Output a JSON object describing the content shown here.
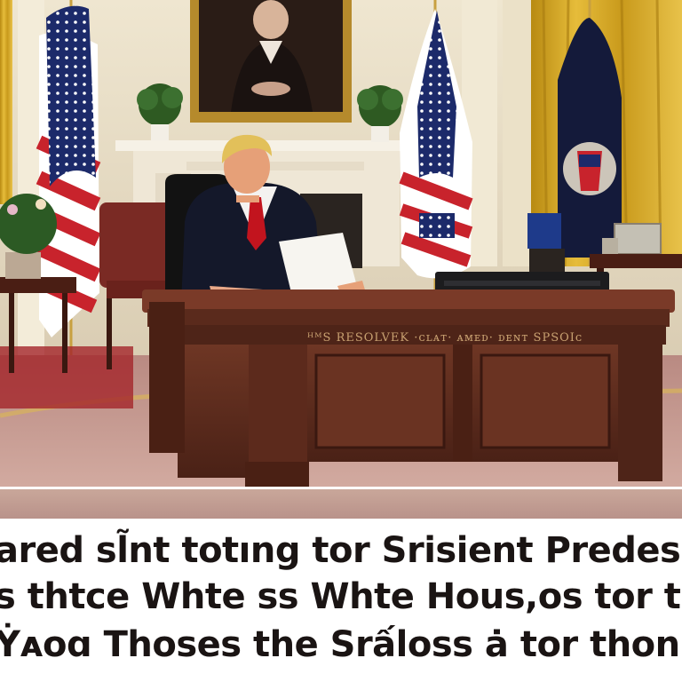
{
  "caption": {
    "line1": "ared sl̃nt totıng tor Srisient Predesin",
    "line2": "s thtce Whte ss Whte Hous,os tor tor",
    "line3": "Ẏᴀᴏɑ Thoses the Srấloss ȧ tor thon th"
  },
  "colors": {
    "wall": "#e6dcc4",
    "curtain": "#d8a820",
    "carpet": "#c99a92",
    "desk": "#5a2a1c",
    "suit": "#14182a",
    "tie": "#c2141e",
    "flag_blue": "#1c2a6a",
    "flag_red": "#c8232c",
    "caption_text": "#1a1413"
  },
  "scene": {
    "subject": "person-at-desk",
    "objects": [
      "portrait-painting",
      "fireplace-mantel",
      "us-flag-left",
      "us-flag-right",
      "presidential-flag",
      "gold-curtain",
      "resolute-desk",
      "office-chair",
      "side-chair",
      "side-table",
      "plant",
      "papers",
      "desk-device",
      "picture-frames"
    ]
  }
}
